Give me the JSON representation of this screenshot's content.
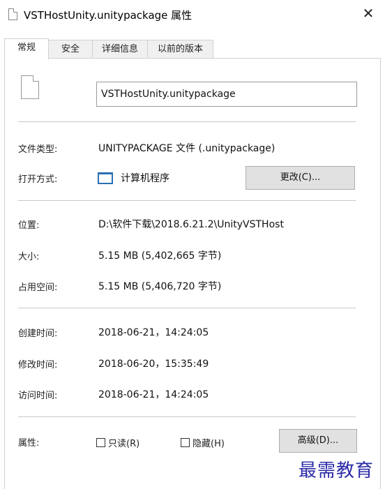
{
  "window": {
    "title": "VSTHostUnity.unitypackage 属性",
    "close_glyph": "✕"
  },
  "tabs": [
    {
      "label": "常规"
    },
    {
      "label": "安全"
    },
    {
      "label": "详细信息"
    },
    {
      "label": "以前的版本"
    }
  ],
  "file": {
    "name": "VSTHostUnity.unitypackage",
    "icon": "generic-file-icon"
  },
  "fields": {
    "type_label": "文件类型:",
    "type_value": "UNITYPACKAGE 文件 (.unitypackage)",
    "open_with_label": "打开方式:",
    "open_with_value": "计算机程序",
    "open_with_icon": "program-window-icon",
    "change_button": "更改(C)...",
    "location_label": "位置:",
    "location_value": "D:\\软件下载\\2018.6.21.2\\UnityVSTHost",
    "size_label": "大小:",
    "size_value": "5.15 MB (5,402,665 字节)",
    "disk_size_label": "占用空间:",
    "disk_size_value": "5.15 MB (5,406,720 字节)",
    "created_label": "创建时间:",
    "created_value": "2018-06-21，14:24:05",
    "modified_label": "修改时间:",
    "modified_value": "2018-06-20，15:35:49",
    "accessed_label": "访问时间:",
    "accessed_value": "2018-06-21，14:24:05",
    "attributes_label": "属性:",
    "readonly_label": "只读(R)",
    "hidden_label": "隐藏(H)",
    "advanced_button": "高级(D)..."
  },
  "watermark": "最需教育",
  "colors": {
    "watermark": "#2b2ba8",
    "app_icon": "#2a6fb3"
  }
}
